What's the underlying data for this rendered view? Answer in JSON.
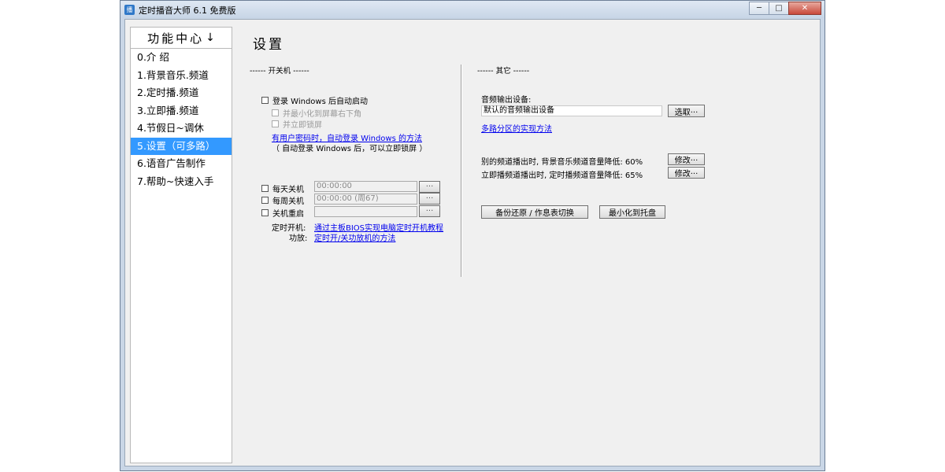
{
  "window": {
    "title": "定时播音大师 6.1 免费版",
    "icon_text": "播",
    "minimize": "─",
    "maximize": "□",
    "close": "✕"
  },
  "sidebar": {
    "header": "功能中心",
    "header_icon": "↓",
    "items": [
      {
        "label": "0.介 绍"
      },
      {
        "label": "1.背景音乐.频道"
      },
      {
        "label": "2.定时播.频道"
      },
      {
        "label": "3.立即播.频道"
      },
      {
        "label": "4.节假日~调休"
      },
      {
        "label": "5.设置（可多路）"
      },
      {
        "label": "6.语音广告制作"
      },
      {
        "label": "7.帮助~快速入手"
      }
    ]
  },
  "page": {
    "title": "设置"
  },
  "power": {
    "caption": "------ 开关机 ------",
    "autostart_label": "登录 Windows 后自动启动",
    "minimize_tray_label": "并最小化到屏幕右下角",
    "lock_screen_label": "并立即锁屏",
    "password_link": "有用户密码时，自动登录 Windows 的方法",
    "password_note": "（ 自动登录 Windows 后，可以立即锁屏 ）",
    "daily_label": "每天关机",
    "daily_value": "00:00:00",
    "weekly_label": "每周关机",
    "weekly_value": "00:00:00 (周67)",
    "restart_label": "关机重启",
    "restart_value": "",
    "more_button": "···",
    "timed_boot_label": "定时开机:",
    "timed_boot_link": "通过主板BIOS实现电脑定时开机教程",
    "amp_label": "功放:",
    "amp_link": "定时开/关功放机的方法"
  },
  "other": {
    "caption": "------ 其它 ------",
    "audio_output_label": "音频输出设备:",
    "audio_output_value": "默认的音频输出设备",
    "select_button": "选取···",
    "multi_zone_link": "多路分区的实现方法",
    "other_channel_text": "别的频道播出时, 背景音乐频道音量降低: 60%",
    "immediate_channel_text": "立即播频道播出时, 定时播频道音量降低: 65%",
    "modify_button": "修改···",
    "backup_button": "备份还原 / 作息表切换",
    "minimize_tray_button": "最小化到托盘"
  }
}
